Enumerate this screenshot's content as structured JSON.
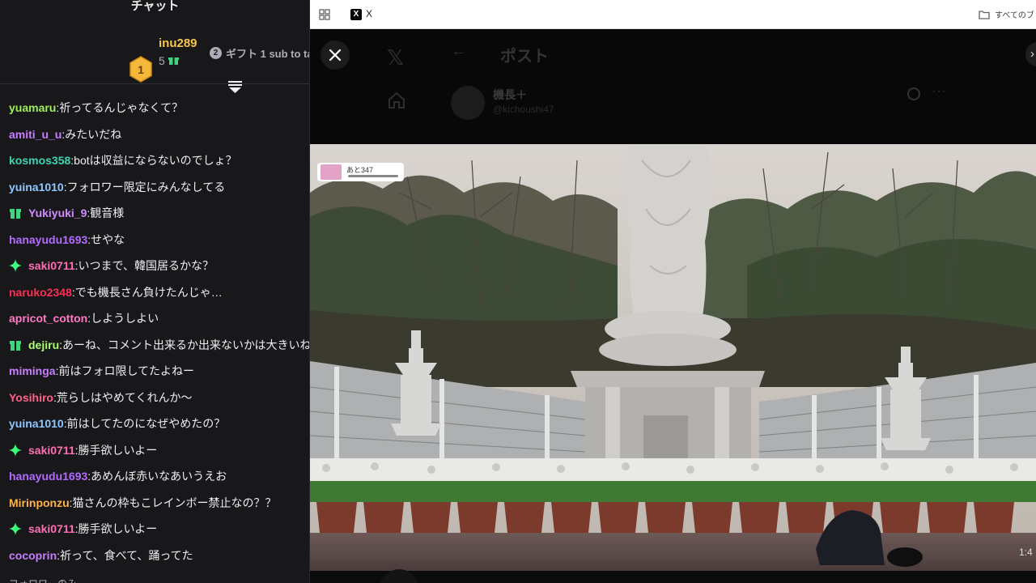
{
  "chat": {
    "title": "チャット",
    "leaderboard": {
      "rank": "1",
      "user": "inu289",
      "count": "5",
      "gift_rank": "2",
      "gift_text": "ギフト 1 sub to ta"
    },
    "messages": [
      {
        "user": "yuamaru",
        "color": "#9ef05a",
        "text": "祈ってるんじゃなくて？",
        "badge": ""
      },
      {
        "user": "amiti_u_u",
        "color": "#c77dff",
        "text": "みたいだね",
        "badge": ""
      },
      {
        "user": "kosmos358",
        "color": "#3fd4b0",
        "text": "botは収益にならないのでしょ？",
        "badge": ""
      },
      {
        "user": "yuina1010",
        "color": "#8fc7ff",
        "text": "フォロワー限定にみんなしてる",
        "badge": ""
      },
      {
        "user": "Yukiyuki_9",
        "color": "#d08cff",
        "text": "観音様",
        "badge": "gift-sub-icon"
      },
      {
        "user": "hanayudu1693",
        "color": "#b36bff",
        "text": "せやな",
        "badge": ""
      },
      {
        "user": "saki0711",
        "color": "#ff6fb3",
        "text": "いつまで、韓国居るかな？",
        "badge": "sparkle-badge-icon"
      },
      {
        "user": "naruko2348",
        "color": "#ff2d55",
        "text": "でも機長さん負けたんじゃ…",
        "badge": ""
      },
      {
        "user": "apricot_cotton",
        "color": "#ff79c6",
        "text": "しようしよい",
        "badge": ""
      },
      {
        "user": "dejiru",
        "color": "#a6ff6e",
        "text": "あーね、コメント出来るか出来ないかは大きいね",
        "badge": "gift-sub-icon"
      },
      {
        "user": "miminga",
        "color": "#c77dff",
        "text": "前はフォロ限してたよねー",
        "badge": ""
      },
      {
        "user": "Yosihiro",
        "color": "#ff5f8a",
        "text": "荒らしはやめてくれんか〜",
        "badge": ""
      },
      {
        "user": "yuina1010",
        "color": "#8fc7ff",
        "text": "前はしてたのになぜやめたの？",
        "badge": ""
      },
      {
        "user": "saki0711",
        "color": "#ff6fb3",
        "text": "勝手欲しいよー",
        "badge": "sparkle-badge-icon"
      },
      {
        "user": "hanayudu1693",
        "color": "#b36bff",
        "text": "あめんぼ赤いなあいうえお",
        "badge": ""
      },
      {
        "user": "Mirinponzu",
        "color": "#ffb347",
        "text": "猫さんの枠もこレインボー禁止なの？？",
        "badge": ""
      },
      {
        "user": "saki0711",
        "color": "#ff6fb3",
        "text": "勝手欲しいよー",
        "badge": "sparkle-badge-icon"
      },
      {
        "user": "cocoprin",
        "color": "#c77dff",
        "text": "祈って、食べて、踊ってた",
        "badge": ""
      }
    ],
    "footer": "フォロワーのみ"
  },
  "browser": {
    "tab_label": "X",
    "tab_favicon": "X",
    "bookmarks_label": "すべてのブック",
    "page": {
      "title": "ポスト",
      "author_name": "機長＋",
      "author_handle": "@kichoushi47",
      "overlay_text": "あと347",
      "video_time": "1:4"
    }
  },
  "colors": {
    "chat_bg": "#18181b",
    "leader_gold": "#f5c54a",
    "gift_green": "#3ed67a",
    "sparkle_green": "#3bff7a"
  }
}
